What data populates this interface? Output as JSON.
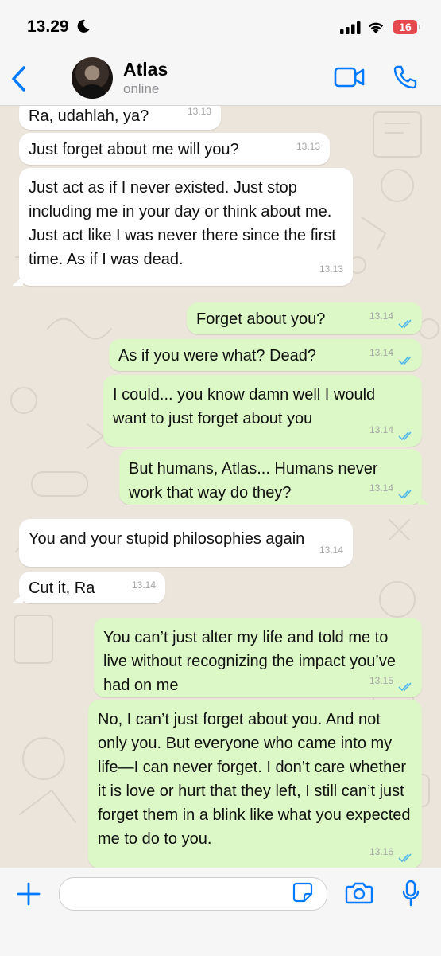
{
  "status": {
    "time": "13.29",
    "battery": "16"
  },
  "contact": {
    "name": "Atlas",
    "status": "online"
  },
  "messages": [
    {
      "dir": "in",
      "text": "Ra, udahlah, ya?",
      "time": "13.13"
    },
    {
      "dir": "in",
      "text": "Just forget about me will you?",
      "time": "13.13"
    },
    {
      "dir": "in",
      "text": "Just act as if I never existed. Just stop including me in your day or think about me. Just act like I was never there since the first time. As if I was dead.",
      "time": "13.13"
    },
    {
      "dir": "out",
      "text": "Forget about you?",
      "time": "13.14"
    },
    {
      "dir": "out",
      "text": "As if you were what? Dead?",
      "time": "13.14"
    },
    {
      "dir": "out",
      "text": "I could... you know damn well I would want to just forget about you",
      "time": "13.14"
    },
    {
      "dir": "out",
      "text": "But humans, Atlas... Humans never work that way do they?",
      "time": "13.14"
    },
    {
      "dir": "in",
      "text": "You and your stupid philosophies again",
      "time": "13.14"
    },
    {
      "dir": "in",
      "text": "Cut it, Ra",
      "time": "13.14"
    },
    {
      "dir": "out",
      "text": "You can’t just alter my life and told me to live without recognizing the impact you’ve had on me",
      "time": "13.15"
    },
    {
      "dir": "out",
      "text": "No, I can’t just forget about you. And not only you. But everyone who came into my life—I can never forget. I don’t care whether it is love or hurt that they left, I still can’t just forget them in a blink like what you expected me to do to you.",
      "time": "13.16"
    }
  ],
  "composer": {
    "placeholder": ""
  },
  "colors": {
    "accent": "#007aff",
    "outgoing": "#dcf8c6",
    "incoming": "#ffffff",
    "read_ticks": "#4fb6ec"
  }
}
